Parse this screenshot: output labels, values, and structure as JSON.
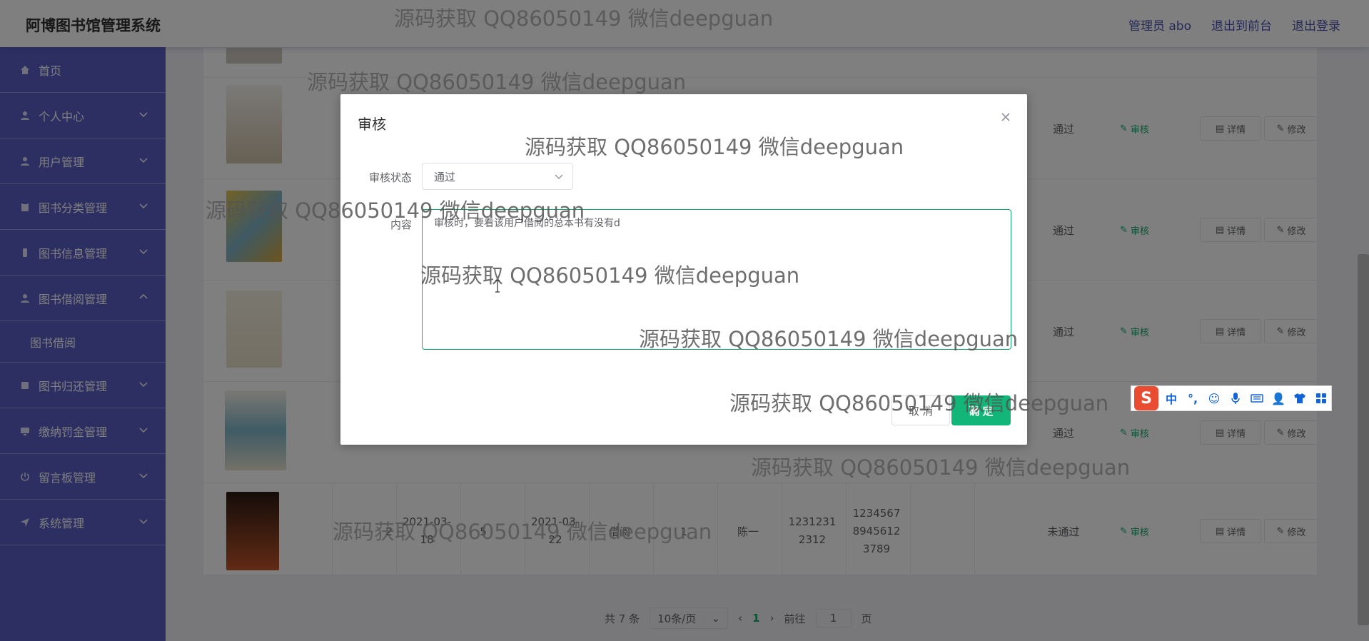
{
  "header": {
    "app_title": "阿博图书馆管理系统",
    "admin_label": "管理员 abo",
    "front_link": "退出到前台",
    "logout_link": "退出登录"
  },
  "sidebar": {
    "items": [
      {
        "label": "首页",
        "icon": "home-icon"
      },
      {
        "label": "个人中心",
        "icon": "user-icon"
      },
      {
        "label": "用户管理",
        "icon": "user-icon"
      },
      {
        "label": "图书分类管理",
        "icon": "clipboard-icon"
      },
      {
        "label": "图书信息管理",
        "icon": "phone-icon"
      },
      {
        "label": "图书借阅管理",
        "icon": "user-icon",
        "expanded": true
      },
      {
        "label": "图书归还管理",
        "icon": "book-icon"
      },
      {
        "label": "缴纳罚金管理",
        "icon": "monitor-icon"
      },
      {
        "label": "留言板管理",
        "icon": "power-icon"
      },
      {
        "label": "系统管理",
        "icon": "send-icon"
      }
    ],
    "submenu": {
      "label": "图书借阅"
    }
  },
  "table": {
    "rows": [
      {
        "status": "通过"
      },
      {
        "status": "通过"
      },
      {
        "status": "通过"
      },
      {
        "status": "通过"
      },
      {
        "status": "未通过",
        "borrow_date": "2021-03-18",
        "days": "5",
        "return_date": "2021-03-22",
        "state": "借阅",
        "qty": "1",
        "name": "陈一",
        "phone": "12312312312",
        "id_number": "123456789456123789"
      }
    ],
    "review_btn": "审核",
    "detail_btn": "详情",
    "edit_btn": "修改",
    "partial_cells": {
      "c2": "2",
      "c3": "3"
    }
  },
  "pager": {
    "total": "共 7 条",
    "page_size": "10条/页",
    "current": "1",
    "goto_label": "前往",
    "goto_value": "1",
    "page_unit": "页"
  },
  "dialog": {
    "title": "审核",
    "status_label": "审核状态",
    "status_value": "通过",
    "content_label": "内容",
    "content_value": "审核时，要看该用户借阅的总本书有没有d",
    "cancel_label": "取 消",
    "ok_label": "确 定"
  },
  "ime": {
    "logo": "S",
    "mode": "中",
    "punct": "°,",
    "icons": [
      "emoji-icon",
      "mic-icon",
      "keyboard-icon",
      "person-icon",
      "shirt-icon",
      "grid-icon"
    ]
  },
  "watermark": "源码获取 QQ86050149 微信deepguan",
  "colors": {
    "sidebar": "#5a5fc7",
    "accent": "#13b679",
    "header_link": "#4b52b0"
  }
}
